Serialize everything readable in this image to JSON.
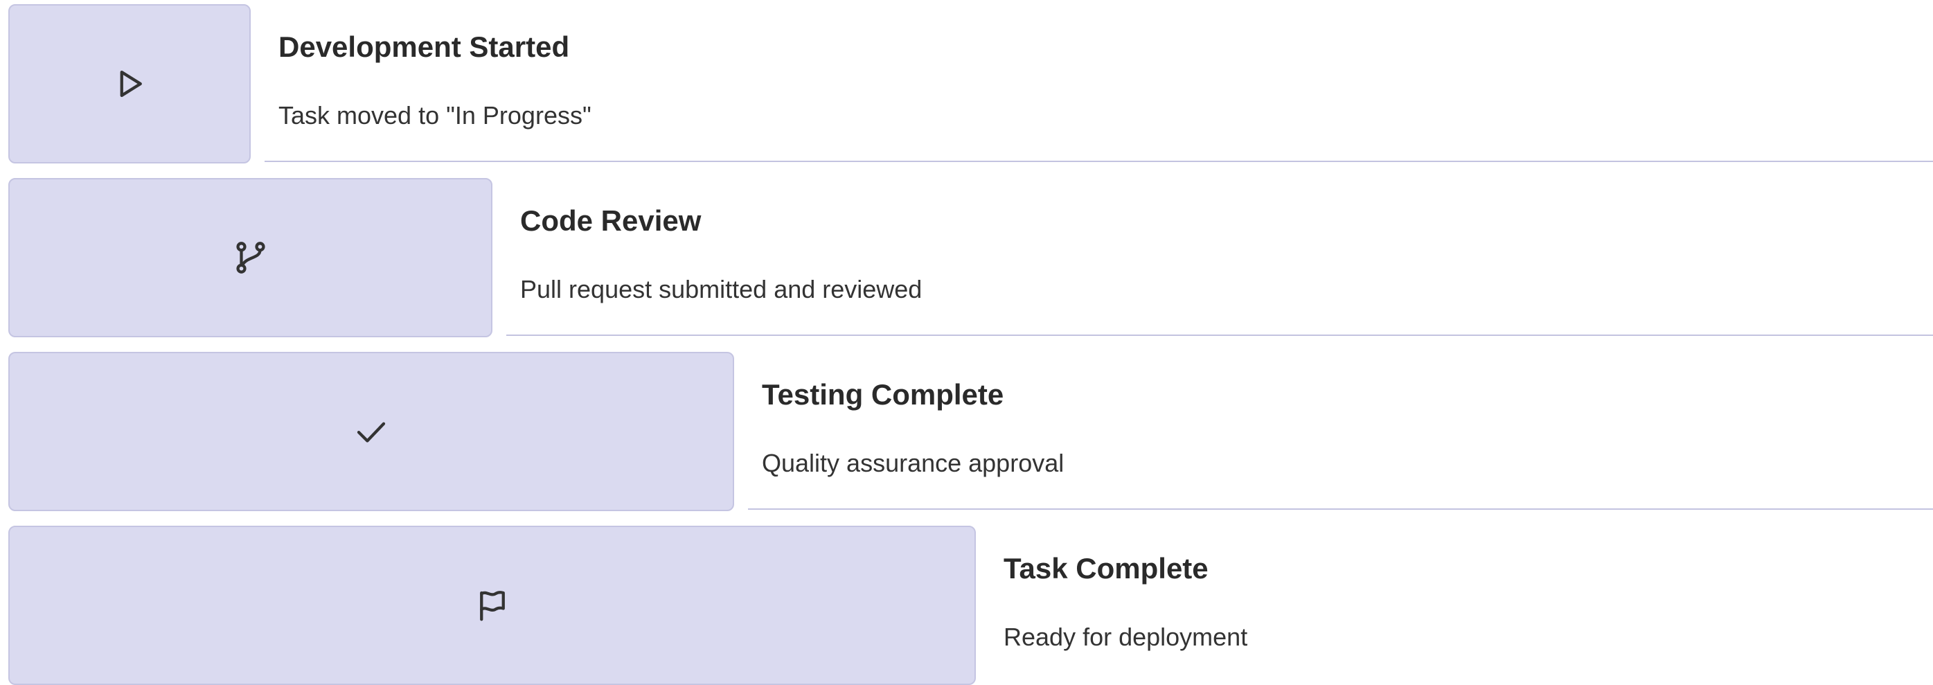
{
  "timeline": {
    "steps": [
      {
        "title": "Development Started",
        "description": "Task moved to \"In Progress\"",
        "icon": "play-icon"
      },
      {
        "title": "Code Review",
        "description": "Pull request submitted and reviewed",
        "icon": "git-branch-icon"
      },
      {
        "title": "Testing Complete",
        "description": "Quality assurance approval",
        "icon": "check-icon"
      },
      {
        "title": "Task Complete",
        "description": "Ready for deployment",
        "icon": "flag-icon"
      }
    ]
  },
  "colors": {
    "tile_background": "#dadaf0",
    "tile_border": "#c5c5e2",
    "divider": "#c3c3e0",
    "text": "#2b2b2b"
  }
}
